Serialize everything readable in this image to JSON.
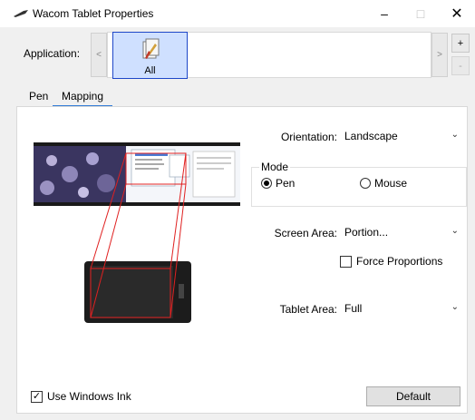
{
  "window": {
    "title": "Wacom Tablet Properties",
    "minimize": "–",
    "maximize": "□",
    "close": "✕"
  },
  "application": {
    "label": "Application:",
    "scroll_left": "<",
    "scroll_right": ">",
    "selected_tile": "All",
    "add": "+",
    "remove": "-"
  },
  "tabs": [
    {
      "label": "Pen"
    },
    {
      "label": "Mapping"
    }
  ],
  "mapping": {
    "orientation_label": "Orientation:",
    "orientation_value": "Landscape",
    "mode_title": "Mode",
    "mode_pen": "Pen",
    "mode_mouse": "Mouse",
    "mode_selected": "Pen",
    "screen_area_label": "Screen Area:",
    "screen_area_value": "Portion...",
    "force_proportions": "Force Proportions",
    "force_proportions_checked": false,
    "tablet_area_label": "Tablet Area:",
    "tablet_area_value": "Full"
  },
  "footer": {
    "use_windows_ink": "Use Windows Ink",
    "use_windows_ink_checked": true,
    "default_button": "Default"
  },
  "colors": {
    "accent": "#2f7bd6",
    "tile_bg": "#cfe0ff",
    "tile_border": "#1e47c8",
    "mapping_lines": "#e02020"
  }
}
